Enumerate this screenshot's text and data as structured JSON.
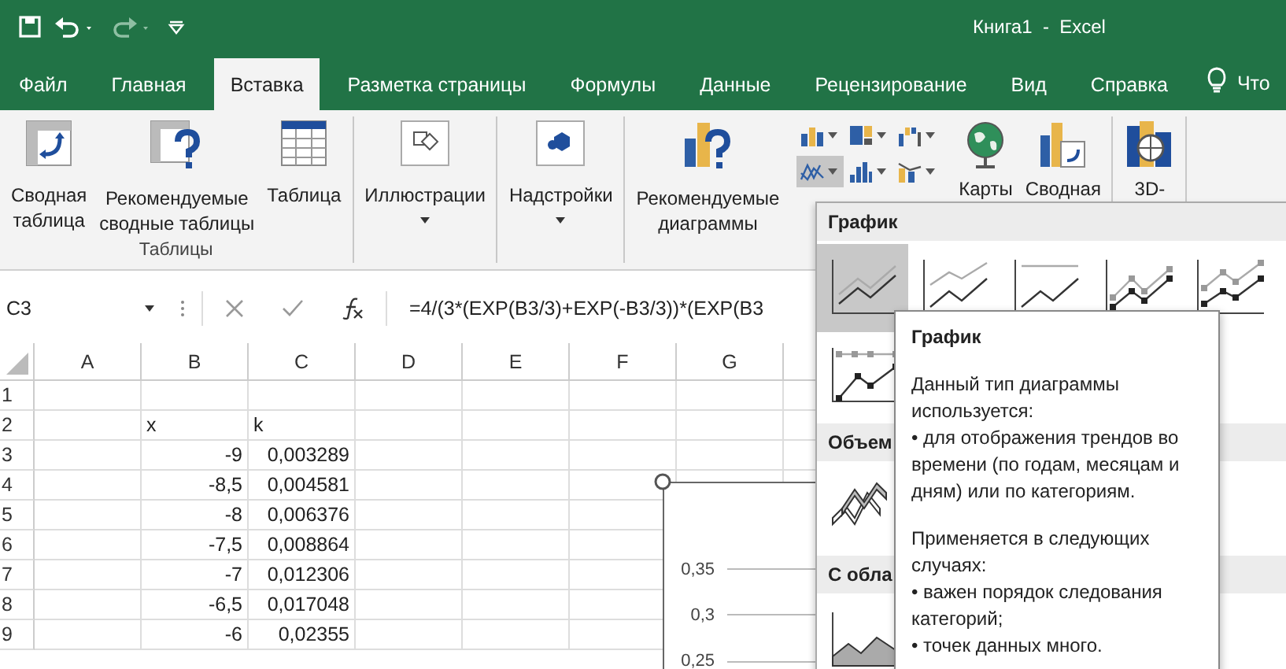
{
  "window": {
    "title": "Книга1  -  Excel"
  },
  "tabs": [
    {
      "label": "Файл",
      "selected": false
    },
    {
      "label": "Главная",
      "selected": false
    },
    {
      "label": "Вставка",
      "selected": true
    },
    {
      "label": "Разметка страницы",
      "selected": false
    },
    {
      "label": "Формулы",
      "selected": false
    },
    {
      "label": "Данные",
      "selected": false
    },
    {
      "label": "Рецензирование",
      "selected": false
    },
    {
      "label": "Вид",
      "selected": false
    },
    {
      "label": "Справка",
      "selected": false
    }
  ],
  "tell_me": {
    "label": "Что"
  },
  "ribbon": {
    "groups": [
      {
        "label": "Таблицы",
        "buttons": [
          {
            "kind": "pivot",
            "lines": [
              "Сводная",
              "таблица"
            ]
          },
          {
            "kind": "recommended_pivot",
            "lines": [
              "Рекомендуемые",
              "сводные таблицы"
            ]
          },
          {
            "kind": "table",
            "lines": [
              "Таблица"
            ]
          }
        ]
      },
      {
        "buttons": [
          {
            "kind": "illustrations",
            "lines": [
              "Иллюстрации"
            ],
            "has_menu": true
          }
        ]
      },
      {
        "buttons": [
          {
            "kind": "addins",
            "lines": [
              "Надстройки"
            ],
            "has_menu": true
          }
        ]
      },
      {
        "buttons": [
          {
            "kind": "recommended_charts",
            "lines": [
              "Рекомендуемые",
              "диаграммы"
            ]
          },
          {
            "kind": "chart_types",
            "items": [
              {
                "kind": "column",
                "selected": false
              },
              {
                "kind": "hierarchy",
                "selected": false
              },
              {
                "kind": "waterfall",
                "selected": false
              },
              {
                "kind": "line",
                "selected": true
              },
              {
                "kind": "statistic",
                "selected": false
              },
              {
                "kind": "combo",
                "selected": false
              }
            ]
          },
          {
            "kind": "maps",
            "lines": [
              "Карты"
            ]
          },
          {
            "kind": "pivot_chart",
            "lines": [
              "Сводная"
            ]
          }
        ]
      },
      {
        "buttons": [
          {
            "kind": "map_3d",
            "lines": [
              "3D-"
            ]
          }
        ]
      }
    ]
  },
  "formula_bar": {
    "name_box": "C3",
    "formula": "=4/(3*(EXP(B3/3)+EXP(-B3/3))*(EXP(B3"
  },
  "sheet": {
    "columns": [
      "A",
      "B",
      "C",
      "D",
      "E",
      "F",
      "G"
    ],
    "rows": [
      {
        "header": "1"
      },
      {
        "header": "2",
        "B": {
          "value": "x",
          "kind": "text"
        },
        "C": {
          "value": "k",
          "kind": "text"
        }
      },
      {
        "header": "3",
        "B": {
          "value": "-9",
          "kind": "number"
        },
        "C": {
          "value": "0,003289",
          "kind": "number"
        }
      },
      {
        "header": "4",
        "B": {
          "value": "-8,5",
          "kind": "number"
        },
        "C": {
          "value": "0,004581",
          "kind": "number"
        }
      },
      {
        "header": "5",
        "B": {
          "value": "-8",
          "kind": "number"
        },
        "C": {
          "value": "0,006376",
          "kind": "number"
        }
      },
      {
        "header": "6",
        "B": {
          "value": "-7,5",
          "kind": "number"
        },
        "C": {
          "value": "0,008864",
          "kind": "number"
        }
      },
      {
        "header": "7",
        "B": {
          "value": "-7",
          "kind": "number"
        },
        "C": {
          "value": "0,012306",
          "kind": "number"
        }
      },
      {
        "header": "8",
        "B": {
          "value": "-6,5",
          "kind": "number"
        },
        "C": {
          "value": "0,017048",
          "kind": "number"
        }
      },
      {
        "header": "9",
        "B": {
          "value": "-6",
          "kind": "number"
        },
        "C": {
          "value": "0,02355",
          "kind": "number"
        }
      }
    ]
  },
  "chart": {
    "axis_labels": [
      "0,35",
      "0,3",
      "0,25"
    ]
  },
  "gallery": {
    "sections": [
      {
        "title": "График",
        "items": [
          {
            "kind": "line",
            "selected": true
          },
          {
            "kind": "stacked_line",
            "selected": false
          },
          {
            "kind": "percent_line",
            "selected": false
          },
          {
            "kind": "line_markers",
            "selected": false
          },
          {
            "kind": "stacked_line_markers",
            "selected": false
          },
          {
            "kind": "percent_line_markers",
            "selected": false
          }
        ]
      },
      {
        "title": "Объем",
        "items": [
          {
            "kind": "line_3d",
            "selected": false
          }
        ]
      },
      {
        "title": "С обла",
        "items": [
          {
            "kind": "area",
            "selected": false
          }
        ]
      }
    ]
  },
  "tooltip": {
    "title": "График",
    "paragraphs": [
      [
        "Данный тип диаграммы используется:",
        "• для отображения трендов во времени (по годам, месяцам и дням) или по категориям."
      ],
      [
        "Применяется в следующих случаях:",
        "• важен порядок следования категорий;",
        "• точек данных много."
      ]
    ]
  }
}
